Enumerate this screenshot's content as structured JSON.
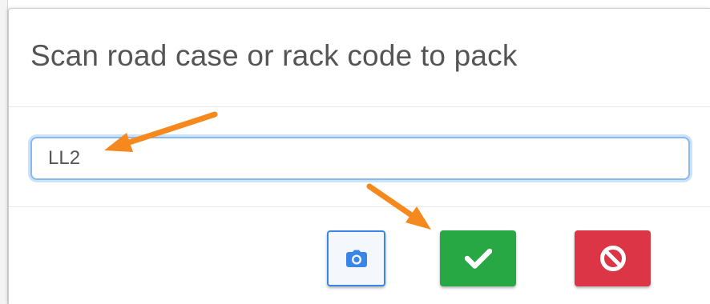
{
  "modal": {
    "title": "Scan road case or rack code to pack"
  },
  "scan_input": {
    "value": "LL2"
  },
  "footer": {
    "camera_icon": "camera-icon",
    "confirm_icon": "check-icon",
    "cancel_icon": "ban-icon"
  },
  "colors": {
    "accent_blue": "#3a86e8",
    "success_green": "#28a745",
    "danger_red": "#dc3545",
    "annotation_orange": "#f5891e",
    "title_text": "#555555"
  }
}
